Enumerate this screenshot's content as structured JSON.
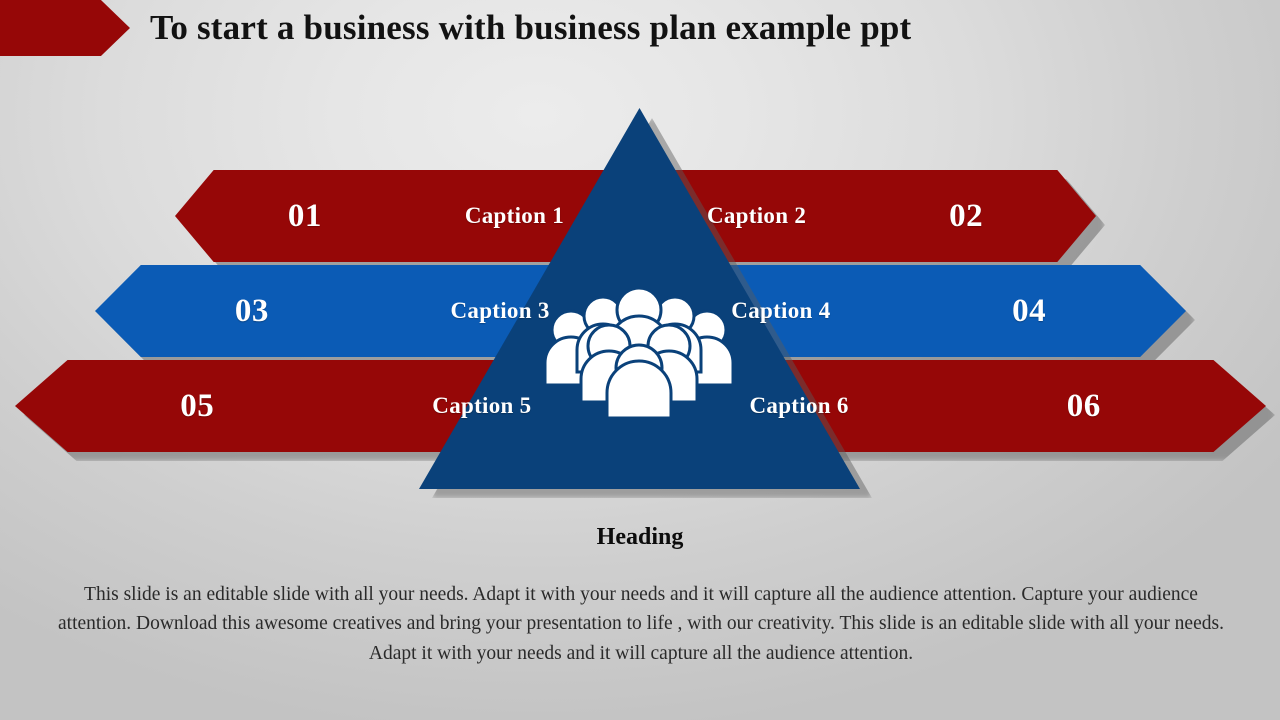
{
  "slide": {
    "title": "To start a business with business plan example ppt",
    "heading": "Heading",
    "body_text": "This slide is an editable slide with all your needs. Adapt it with your needs and it will capture all the audience attention. Capture your audience attention. Download this awesome creatives and bring your presentation to life , with our creativity. This slide is an editable slide with all your needs. Adapt it with your needs and it will capture all the audience attention."
  },
  "center": {
    "icon": "group-of-people-icon"
  },
  "bands": [
    {
      "row": 1,
      "color": "#960707",
      "left": {
        "number": "01",
        "caption": "Caption 1"
      },
      "right": {
        "number": "02",
        "caption": "Caption 2"
      }
    },
    {
      "row": 2,
      "color": "#0b5bb5",
      "left": {
        "number": "03",
        "caption": "Caption 3"
      },
      "right": {
        "number": "04",
        "caption": "Caption 4"
      }
    },
    {
      "row": 3,
      "color": "#960707",
      "left": {
        "number": "05",
        "caption": "Caption 5"
      },
      "right": {
        "number": "06",
        "caption": "Caption 6"
      }
    }
  ],
  "colors": {
    "dark_red": "#960707",
    "bright_blue": "#0b5bb5",
    "navy_triangle": "#0a417a",
    "background_light": "#e6e6e6",
    "background_dark": "#c3c3c3",
    "title_text": "#121212",
    "band_text": "#ffffff"
  }
}
